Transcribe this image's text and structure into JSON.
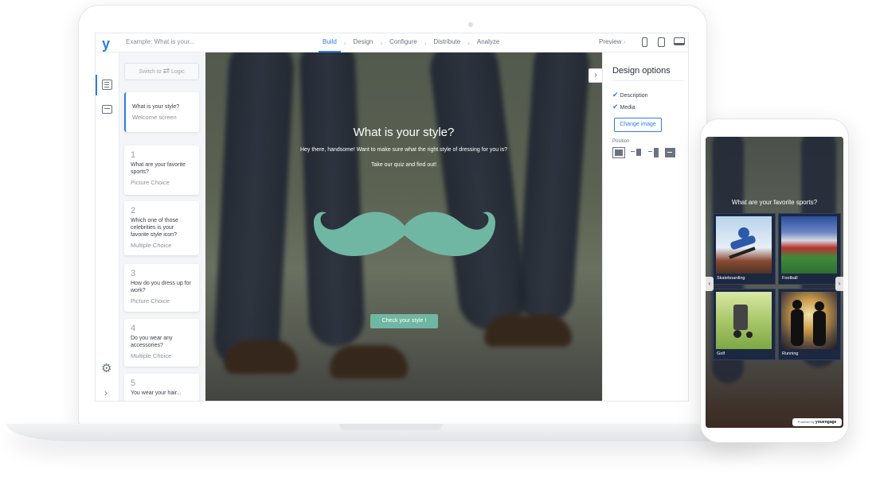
{
  "app": {
    "quiz_title": "Example: What is your...",
    "tabs": [
      "Build",
      "Design",
      "Configure",
      "Distribute",
      "Analyze"
    ],
    "active_tab": "Build",
    "preview_label": "Preview",
    "logo_text": "y"
  },
  "sidebar": {
    "switch_prefix": "Switch to",
    "switch_target": "Logic"
  },
  "questions": [
    {
      "num": "",
      "text": "What is your style?",
      "type": "Welcome screen"
    },
    {
      "num": "1",
      "text": "What are your favorite sports?",
      "type": "Picture Choice"
    },
    {
      "num": "2",
      "text": "Which one of those celebrities is your favorite style icon?",
      "type": "Multiple Choice"
    },
    {
      "num": "3",
      "text": "How do you dress up for work?",
      "type": "Picture Choice"
    },
    {
      "num": "4",
      "text": "Do you wear any accessories?",
      "type": "Multiple Choice"
    },
    {
      "num": "5",
      "text": "You wear your hair...",
      "type": ""
    }
  ],
  "canvas": {
    "title": "What is your style?",
    "description": "Hey there, handsome! Want to make sure what the right style of dressing for you is?",
    "subtitle": "Take our quiz and find out!",
    "cta": "Check your style !",
    "accent": "#6fb7a3"
  },
  "design_options": {
    "title": "Design options",
    "description_label": "Description",
    "media_label": "Media",
    "change_image": "Change image",
    "position_label": "Position"
  },
  "phone": {
    "question": "What are your favorite sports?",
    "choices": [
      "Skateboarding",
      "Football",
      "Golf",
      "Running"
    ],
    "powered_by": "Powered by",
    "brand": "youengage"
  },
  "colors": {
    "primary": "#2f7be5"
  }
}
